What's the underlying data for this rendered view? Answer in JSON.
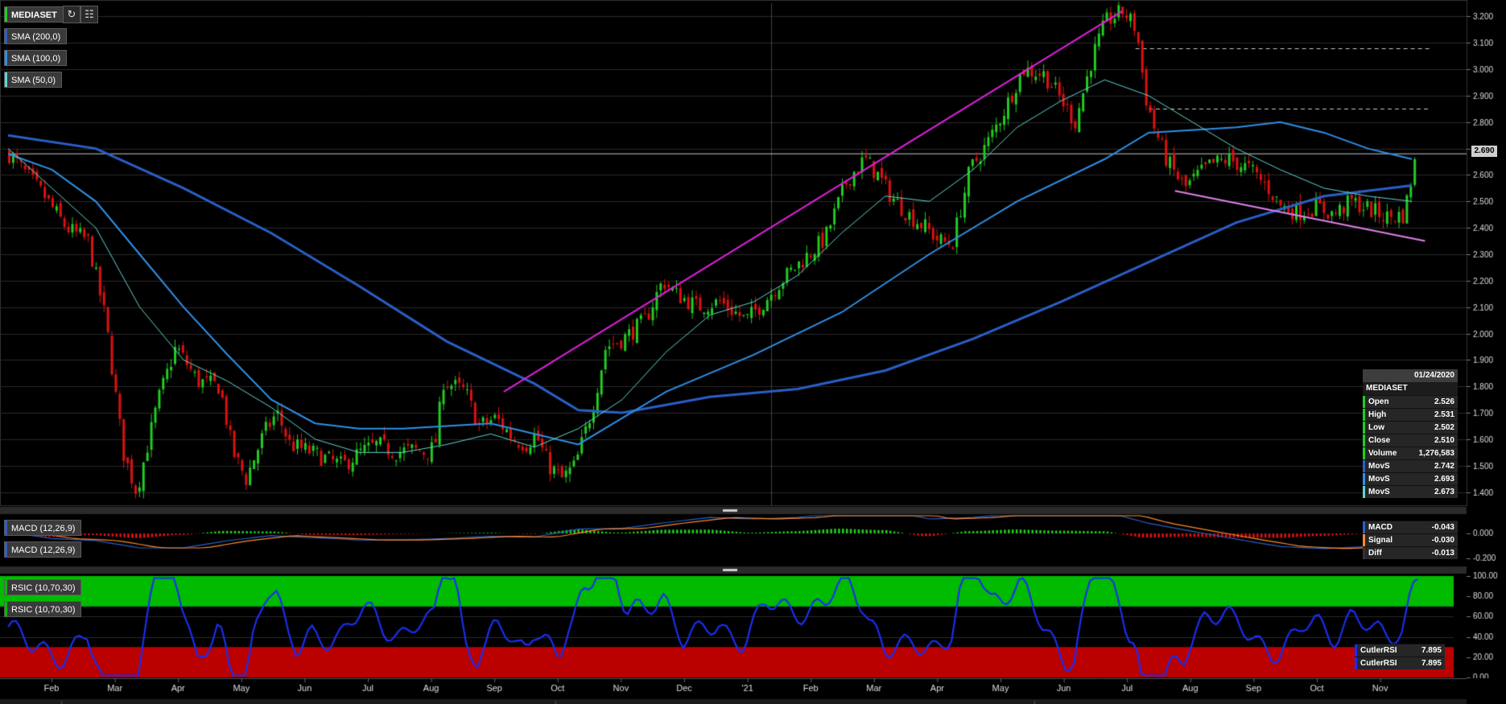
{
  "symbol": "MEDIASET",
  "price_tag": "2.690",
  "indicators": {
    "price": [
      "SMA (200,0)",
      "SMA (100,0)",
      "SMA (50,0)"
    ],
    "macd": [
      "MACD (12,26,9)",
      "MACD (12,26,9)"
    ],
    "rsi": [
      "RSIC (10,70,30)",
      "RSIC (10,70,30)"
    ]
  },
  "data_window": {
    "date": "01/24/2020",
    "name": "MEDIASET",
    "rows": [
      {
        "label": "Open",
        "value": "2.526"
      },
      {
        "label": "High",
        "value": "2.531"
      },
      {
        "label": "Low",
        "value": "2.502"
      },
      {
        "label": "Close",
        "value": "2.510"
      },
      {
        "label": "Volume",
        "value": "1,276,583"
      },
      {
        "label": "MovS",
        "value": "2.742"
      },
      {
        "label": "MovS",
        "value": "2.693"
      },
      {
        "label": "MovS",
        "value": "2.673"
      }
    ]
  },
  "macd_window": [
    {
      "label": "MACD",
      "value": "-0.043"
    },
    {
      "label": "Signal",
      "value": "-0.030"
    },
    {
      "label": "Diff",
      "value": "-0.013"
    }
  ],
  "rsi_window": [
    {
      "label": "CutlerRSI",
      "value": "7.895"
    },
    {
      "label": "CutlerRSI",
      "value": "7.895"
    }
  ],
  "colors": {
    "up": "#22cc22",
    "down": "#dd1111",
    "sma200": "#2a5fc7",
    "sma100": "#2f8fe6",
    "sma50": "#5fd6d0",
    "trend_upper": "#e020e0",
    "trend_lower": "#e080e8",
    "rsi_line": "#1a2ef0",
    "rsi_over": "#00bb00",
    "rsi_under": "#bb0000",
    "panel_sep": "#2a2a2a"
  },
  "chart_data": {
    "type": "candlestick",
    "x_axis_labels": [
      "Feb",
      "Mar",
      "Apr",
      "May",
      "Jun",
      "Jul",
      "Aug",
      "Sep",
      "Oct",
      "Nov",
      "Dec",
      "'21",
      "Feb",
      "Mar",
      "Apr",
      "May",
      "Jun",
      "Jul",
      "Aug",
      "Sep",
      "Oct",
      "Nov"
    ],
    "price_axis": {
      "ticks": [
        "1.400",
        "1.500",
        "1.600",
        "1.700",
        "1.800",
        "1.900",
        "2.000",
        "2.100",
        "2.200",
        "2.300",
        "2.400",
        "2.500",
        "2.600",
        "2.700",
        "2.800",
        "2.900",
        "3.000",
        "3.100",
        "3.200"
      ],
      "ylim": [
        1.35,
        3.25
      ]
    },
    "close_path": [
      [
        0,
        2.68
      ],
      [
        0.8,
        2.52
      ],
      [
        1.3,
        2.4
      ],
      [
        1.8,
        2.35
      ],
      [
        2.2,
        2.05
      ],
      [
        2.6,
        1.55
      ],
      [
        2.9,
        1.4
      ],
      [
        3.4,
        1.75
      ],
      [
        3.8,
        1.95
      ],
      [
        4.3,
        1.82
      ],
      [
        4.8,
        1.8
      ],
      [
        5.1,
        1.55
      ],
      [
        5.4,
        1.45
      ],
      [
        5.8,
        1.62
      ],
      [
        6.1,
        1.7
      ],
      [
        6.4,
        1.58
      ],
      [
        6.9,
        1.55
      ],
      [
        7.3,
        1.52
      ],
      [
        7.6,
        1.5
      ],
      [
        8.0,
        1.55
      ],
      [
        8.4,
        1.58
      ],
      [
        8.8,
        1.55
      ],
      [
        9.2,
        1.56
      ],
      [
        9.5,
        1.55
      ],
      [
        9.7,
        1.57
      ],
      [
        9.9,
        1.82
      ],
      [
        10.4,
        1.78
      ],
      [
        10.7,
        1.65
      ],
      [
        11.1,
        1.68
      ],
      [
        11.5,
        1.6
      ],
      [
        11.8,
        1.58
      ],
      [
        12.0,
        1.62
      ],
      [
        12.3,
        1.5
      ],
      [
        12.6,
        1.45
      ],
      [
        12.9,
        1.5
      ],
      [
        13.3,
        1.72
      ],
      [
        13.6,
        1.95
      ],
      [
        14.0,
        1.98
      ],
      [
        14.5,
        2.05
      ],
      [
        14.9,
        2.2
      ],
      [
        15.2,
        2.15
      ],
      [
        15.7,
        2.1
      ],
      [
        16.2,
        2.12
      ],
      [
        16.8,
        2.05
      ],
      [
        17.2,
        2.12
      ],
      [
        17.6,
        2.2
      ],
      [
        18.1,
        2.28
      ],
      [
        18.6,
        2.36
      ],
      [
        19.1,
        2.58
      ],
      [
        19.5,
        2.66
      ],
      [
        19.8,
        2.6
      ],
      [
        20.1,
        2.52
      ],
      [
        20.5,
        2.45
      ],
      [
        20.9,
        2.4
      ],
      [
        21.2,
        2.35
      ],
      [
        21.5,
        2.34
      ],
      [
        21.9,
        2.62
      ],
      [
        22.3,
        2.72
      ],
      [
        22.7,
        2.85
      ],
      [
        23.1,
        3.0
      ],
      [
        23.6,
        2.98
      ],
      [
        24.0,
        2.88
      ],
      [
        24.3,
        2.8
      ],
      [
        24.7,
        3.05
      ],
      [
        25.0,
        3.18
      ],
      [
        25.4,
        3.22
      ],
      [
        25.7,
        3.15
      ],
      [
        25.9,
        2.9
      ],
      [
        26.1,
        2.78
      ],
      [
        26.4,
        2.65
      ],
      [
        26.8,
        2.55
      ],
      [
        27.1,
        2.6
      ],
      [
        27.4,
        2.64
      ],
      [
        27.8,
        2.66
      ],
      [
        28.3,
        2.62
      ],
      [
        28.7,
        2.55
      ],
      [
        29.0,
        2.48
      ],
      [
        29.4,
        2.46
      ],
      [
        29.8,
        2.48
      ],
      [
        30.2,
        2.45
      ],
      [
        30.6,
        2.5
      ],
      [
        31.0,
        2.47
      ],
      [
        31.4,
        2.44
      ],
      [
        31.8,
        2.45
      ],
      [
        32.0,
        2.62
      ],
      [
        32.1,
        2.68
      ]
    ],
    "sma200": [
      [
        0,
        2.75
      ],
      [
        2,
        2.7
      ],
      [
        4,
        2.55
      ],
      [
        6,
        2.38
      ],
      [
        8,
        2.18
      ],
      [
        10,
        1.97
      ],
      [
        12,
        1.81
      ],
      [
        13,
        1.71
      ],
      [
        14,
        1.7
      ],
      [
        15,
        1.73
      ],
      [
        16,
        1.76
      ],
      [
        18,
        1.79
      ],
      [
        20,
        1.86
      ],
      [
        22,
        1.98
      ],
      [
        24,
        2.12
      ],
      [
        26,
        2.27
      ],
      [
        28,
        2.42
      ],
      [
        30,
        2.52
      ],
      [
        32,
        2.56
      ]
    ],
    "sma100": [
      [
        0,
        2.68
      ],
      [
        1,
        2.62
      ],
      [
        2,
        2.5
      ],
      [
        3,
        2.3
      ],
      [
        4,
        2.1
      ],
      [
        5,
        1.92
      ],
      [
        6,
        1.75
      ],
      [
        7,
        1.66
      ],
      [
        8,
        1.64
      ],
      [
        9,
        1.64
      ],
      [
        10,
        1.65
      ],
      [
        11,
        1.66
      ],
      [
        12,
        1.62
      ],
      [
        13,
        1.58
      ],
      [
        14,
        1.68
      ],
      [
        15,
        1.78
      ],
      [
        17,
        1.92
      ],
      [
        19,
        2.08
      ],
      [
        21,
        2.3
      ],
      [
        23,
        2.5
      ],
      [
        25,
        2.66
      ],
      [
        26,
        2.76
      ],
      [
        28,
        2.78
      ],
      [
        29,
        2.8
      ],
      [
        30,
        2.76
      ],
      [
        31,
        2.7
      ],
      [
        32,
        2.66
      ]
    ],
    "sma50": [
      [
        0,
        2.7
      ],
      [
        1,
        2.55
      ],
      [
        2,
        2.4
      ],
      [
        3,
        2.1
      ],
      [
        4,
        1.9
      ],
      [
        5,
        1.82
      ],
      [
        6,
        1.72
      ],
      [
        7,
        1.6
      ],
      [
        8,
        1.55
      ],
      [
        9,
        1.55
      ],
      [
        10,
        1.58
      ],
      [
        11,
        1.62
      ],
      [
        12,
        1.57
      ],
      [
        13,
        1.64
      ],
      [
        14,
        1.75
      ],
      [
        15,
        1.93
      ],
      [
        16,
        2.07
      ],
      [
        17,
        2.12
      ],
      [
        18,
        2.22
      ],
      [
        19,
        2.38
      ],
      [
        20,
        2.52
      ],
      [
        21,
        2.5
      ],
      [
        22,
        2.62
      ],
      [
        23,
        2.78
      ],
      [
        24,
        2.88
      ],
      [
        25,
        2.96
      ],
      [
        26,
        2.9
      ],
      [
        27,
        2.8
      ],
      [
        28,
        2.7
      ],
      [
        29,
        2.62
      ],
      [
        30,
        2.55
      ],
      [
        31,
        2.52
      ],
      [
        32,
        2.5
      ]
    ],
    "trend_upper": [
      [
        11.3,
        1.78
      ],
      [
        25.4,
        3.22
      ]
    ],
    "trend_lower": [
      [
        26.6,
        2.54
      ],
      [
        32.3,
        2.35
      ]
    ],
    "resistance": [
      [
        2.68,
        0,
        32.2
      ],
      [
        3.08,
        25.7,
        32.4
      ],
      [
        2.85,
        26.0,
        32.4
      ]
    ],
    "macd_axis": {
      "ticks": [
        "0.000",
        "-0.200"
      ]
    },
    "rsi_axis": {
      "ticks": [
        "100.00",
        "80.00",
        "60.00",
        "40.00",
        "20.00",
        "0.00"
      ]
    },
    "rsi_zones": {
      "overbought": 70,
      "oversold": 30
    }
  }
}
